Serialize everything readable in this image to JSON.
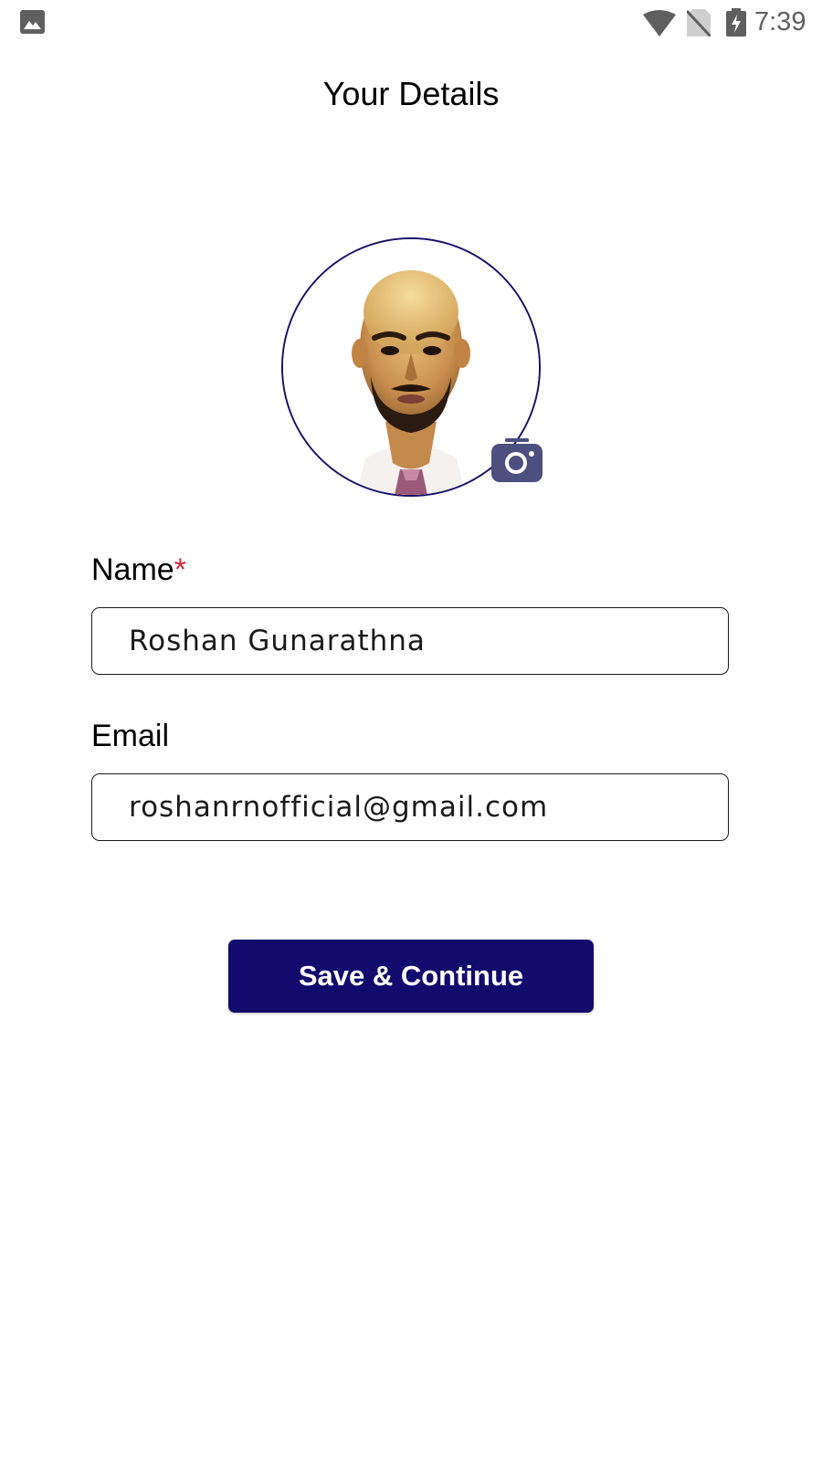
{
  "status_bar": {
    "time": "7:39",
    "icons": [
      "gallery-icon",
      "wifi-icon",
      "no-sim-icon",
      "battery-charging-icon"
    ]
  },
  "header": {
    "title": "Your Details"
  },
  "profile": {
    "photo_alt": "Profile photo",
    "camera_icon": "camera-icon"
  },
  "form": {
    "name_label": "Name",
    "name_required_mark": "*",
    "name_value": "Roshan Gunarathna",
    "email_label": "Email",
    "email_value": "roshanrnofficial@gmail.com"
  },
  "actions": {
    "save_label": "Save & Continue"
  },
  "colors": {
    "primary": "#120a6c",
    "avatar_border": "#16106b",
    "required": "#d2293b",
    "camera_badge": "#4d4f7e"
  }
}
